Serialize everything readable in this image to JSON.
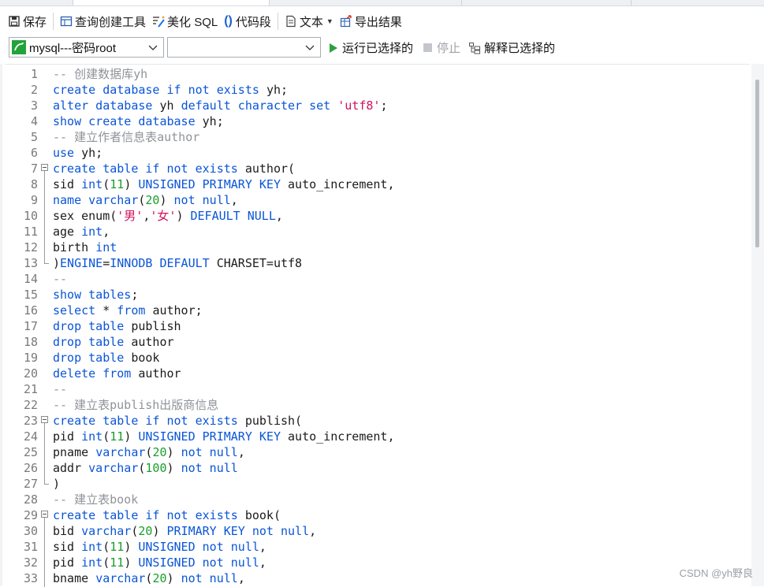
{
  "toolbar": {
    "save": "保存",
    "query_builder": "查询创建工具",
    "beautify_sql": "美化 SQL",
    "code_snippet": "代码段",
    "text": "文本",
    "export_results": "导出结果"
  },
  "toolbar2": {
    "connection": "mysql---密码root",
    "database": "",
    "run_selected": "运行已选择的",
    "stop": "停止",
    "explain_selected": "解释已选择的"
  },
  "colors": {
    "keyword": "#0a55d8",
    "comment": "#8f9399",
    "string": "#d1105b",
    "number": "#1a9e2a",
    "run_green": "#2ea043",
    "connection_green": "#22a33a"
  },
  "editor": {
    "lines": [
      {
        "n": "1",
        "fold": "",
        "tokens": [
          [
            "cm",
            "-- 创建数据库yh"
          ]
        ]
      },
      {
        "n": "2",
        "fold": "",
        "tokens": [
          [
            "kw",
            "create database if not exists "
          ],
          [
            "pl",
            "yh;"
          ]
        ]
      },
      {
        "n": "3",
        "fold": "",
        "tokens": [
          [
            "kw",
            "alter database "
          ],
          [
            "pl",
            "yh "
          ],
          [
            "kw",
            "default character set "
          ],
          [
            "str",
            "'utf8'"
          ],
          [
            "pl",
            ";"
          ]
        ]
      },
      {
        "n": "4",
        "fold": "",
        "tokens": [
          [
            "kw",
            "show create database "
          ],
          [
            "pl",
            "yh;"
          ]
        ]
      },
      {
        "n": "5",
        "fold": "",
        "tokens": [
          [
            "cm",
            "-- 建立作者信息表author"
          ]
        ]
      },
      {
        "n": "6",
        "fold": "",
        "tokens": [
          [
            "kw",
            "use "
          ],
          [
            "pl",
            "yh;"
          ]
        ]
      },
      {
        "n": "7",
        "fold": "start",
        "tokens": [
          [
            "kw",
            "create table if not exists "
          ],
          [
            "pl",
            "author("
          ]
        ]
      },
      {
        "n": "8",
        "fold": "in",
        "tokens": [
          [
            "pl",
            "sid "
          ],
          [
            "kw",
            "int"
          ],
          [
            "pl",
            "("
          ],
          [
            "num",
            "11"
          ],
          [
            "pl",
            ") "
          ],
          [
            "kw",
            "UNSIGNED PRIMARY KEY "
          ],
          [
            "pl",
            "auto_increment,"
          ]
        ]
      },
      {
        "n": "9",
        "fold": "in",
        "tokens": [
          [
            "kw",
            "name varchar"
          ],
          [
            "pl",
            "("
          ],
          [
            "num",
            "20"
          ],
          [
            "pl",
            ") "
          ],
          [
            "kw",
            "not null"
          ],
          [
            "pl",
            ","
          ]
        ]
      },
      {
        "n": "10",
        "fold": "in",
        "tokens": [
          [
            "pl",
            "sex enum("
          ],
          [
            "str",
            "'男'"
          ],
          [
            "pl",
            ","
          ],
          [
            "str",
            "'女'"
          ],
          [
            "pl",
            ") "
          ],
          [
            "kw",
            "DEFAULT NULL"
          ],
          [
            "pl",
            ","
          ]
        ]
      },
      {
        "n": "11",
        "fold": "in",
        "tokens": [
          [
            "pl",
            "age "
          ],
          [
            "kw",
            "int"
          ],
          [
            "pl",
            ","
          ]
        ]
      },
      {
        "n": "12",
        "fold": "in",
        "tokens": [
          [
            "pl",
            "birth "
          ],
          [
            "kw",
            "int"
          ]
        ]
      },
      {
        "n": "13",
        "fold": "end",
        "tokens": [
          [
            "pl",
            ")"
          ],
          [
            "kw",
            "ENGINE"
          ],
          [
            "pl",
            "="
          ],
          [
            "kw",
            "INNODB DEFAULT "
          ],
          [
            "pl",
            "CHARSET=utf8"
          ]
        ]
      },
      {
        "n": "14",
        "fold": "",
        "tokens": [
          [
            "cm",
            "--"
          ]
        ]
      },
      {
        "n": "15",
        "fold": "",
        "tokens": [
          [
            "kw",
            "show tables"
          ],
          [
            "pl",
            ";"
          ]
        ]
      },
      {
        "n": "16",
        "fold": "",
        "tokens": [
          [
            "kw",
            "select "
          ],
          [
            "pl",
            "* "
          ],
          [
            "kw",
            "from "
          ],
          [
            "pl",
            "author;"
          ]
        ]
      },
      {
        "n": "17",
        "fold": "",
        "tokens": [
          [
            "kw",
            "drop table "
          ],
          [
            "pl",
            "publish"
          ]
        ]
      },
      {
        "n": "18",
        "fold": "",
        "tokens": [
          [
            "kw",
            "drop table "
          ],
          [
            "pl",
            "author"
          ]
        ]
      },
      {
        "n": "19",
        "fold": "",
        "tokens": [
          [
            "kw",
            "drop table "
          ],
          [
            "pl",
            "book"
          ]
        ]
      },
      {
        "n": "20",
        "fold": "",
        "tokens": [
          [
            "kw",
            "delete from "
          ],
          [
            "pl",
            "author"
          ]
        ]
      },
      {
        "n": "21",
        "fold": "",
        "tokens": [
          [
            "cm",
            "--"
          ]
        ]
      },
      {
        "n": "22",
        "fold": "",
        "tokens": [
          [
            "cm",
            "-- 建立表publish出版商信息"
          ]
        ]
      },
      {
        "n": "23",
        "fold": "start",
        "tokens": [
          [
            "kw",
            "create table if not exists "
          ],
          [
            "pl",
            "publish("
          ]
        ]
      },
      {
        "n": "24",
        "fold": "in",
        "tokens": [
          [
            "pl",
            "pid "
          ],
          [
            "kw",
            "int"
          ],
          [
            "pl",
            "("
          ],
          [
            "num",
            "11"
          ],
          [
            "pl",
            ") "
          ],
          [
            "kw",
            "UNSIGNED PRIMARY KEY "
          ],
          [
            "pl",
            "auto_increment,"
          ]
        ]
      },
      {
        "n": "25",
        "fold": "in",
        "tokens": [
          [
            "pl",
            "pname "
          ],
          [
            "kw",
            "varchar"
          ],
          [
            "pl",
            "("
          ],
          [
            "num",
            "20"
          ],
          [
            "pl",
            ") "
          ],
          [
            "kw",
            "not null"
          ],
          [
            "pl",
            ","
          ]
        ]
      },
      {
        "n": "26",
        "fold": "in",
        "tokens": [
          [
            "pl",
            "addr "
          ],
          [
            "kw",
            "varchar"
          ],
          [
            "pl",
            "("
          ],
          [
            "num",
            "100"
          ],
          [
            "pl",
            ") "
          ],
          [
            "kw",
            "not null"
          ]
        ]
      },
      {
        "n": "27",
        "fold": "end",
        "tokens": [
          [
            "pl",
            ")"
          ]
        ]
      },
      {
        "n": "28",
        "fold": "",
        "tokens": [
          [
            "cm",
            "-- 建立表book"
          ]
        ]
      },
      {
        "n": "29",
        "fold": "start",
        "tokens": [
          [
            "kw",
            "create table if not exists "
          ],
          [
            "pl",
            "book("
          ]
        ]
      },
      {
        "n": "30",
        "fold": "in",
        "tokens": [
          [
            "pl",
            "bid "
          ],
          [
            "kw",
            "varchar"
          ],
          [
            "pl",
            "("
          ],
          [
            "num",
            "20"
          ],
          [
            "pl",
            ") "
          ],
          [
            "kw",
            "PRIMARY KEY not null"
          ],
          [
            "pl",
            ","
          ]
        ]
      },
      {
        "n": "31",
        "fold": "in",
        "tokens": [
          [
            "pl",
            "sid "
          ],
          [
            "kw",
            "int"
          ],
          [
            "pl",
            "("
          ],
          [
            "num",
            "11"
          ],
          [
            "pl",
            ") "
          ],
          [
            "kw",
            "UNSIGNED not null"
          ],
          [
            "pl",
            ","
          ]
        ]
      },
      {
        "n": "32",
        "fold": "in",
        "tokens": [
          [
            "pl",
            "pid "
          ],
          [
            "kw",
            "int"
          ],
          [
            "pl",
            "("
          ],
          [
            "num",
            "11"
          ],
          [
            "pl",
            ") "
          ],
          [
            "kw",
            "UNSIGNED not null"
          ],
          [
            "pl",
            ","
          ]
        ]
      },
      {
        "n": "33",
        "fold": "in",
        "tokens": [
          [
            "pl",
            "bname "
          ],
          [
            "kw",
            "varchar"
          ],
          [
            "pl",
            "("
          ],
          [
            "num",
            "20"
          ],
          [
            "pl",
            ") "
          ],
          [
            "kw",
            "not null"
          ],
          [
            "pl",
            ","
          ]
        ]
      }
    ]
  },
  "watermark": "CSDN @yh野良"
}
